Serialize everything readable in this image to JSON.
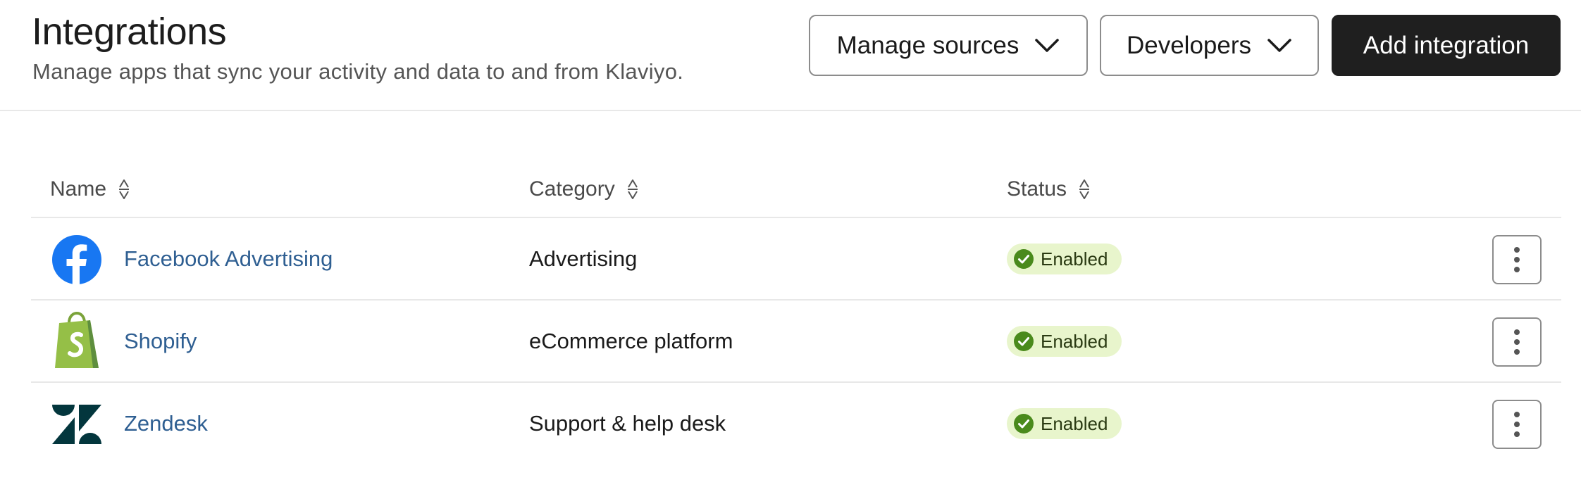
{
  "header": {
    "title": "Integrations",
    "subtitle": "Manage apps that sync your activity and data to and from Klaviyo.",
    "manage_sources_label": "Manage sources",
    "developers_label": "Developers",
    "add_integration_label": "Add integration"
  },
  "table": {
    "columns": {
      "name": "Name",
      "category": "Category",
      "status": "Status"
    },
    "rows": [
      {
        "name": "Facebook Advertising",
        "category": "Advertising",
        "status": "Enabled",
        "icon": "facebook-icon"
      },
      {
        "name": "Shopify",
        "category": "eCommerce platform",
        "status": "Enabled",
        "icon": "shopify-icon"
      },
      {
        "name": "Zendesk",
        "category": "Support & help desk",
        "status": "Enabled",
        "icon": "zendesk-icon"
      }
    ]
  },
  "colors": {
    "link": "#2f5f92",
    "primary_button": "#1f1f1f",
    "badge_bg": "#e8f5cc",
    "badge_check": "#4a8a1c",
    "facebook": "#1877f2",
    "shopify": "#95bf47",
    "zendesk": "#03363d"
  }
}
